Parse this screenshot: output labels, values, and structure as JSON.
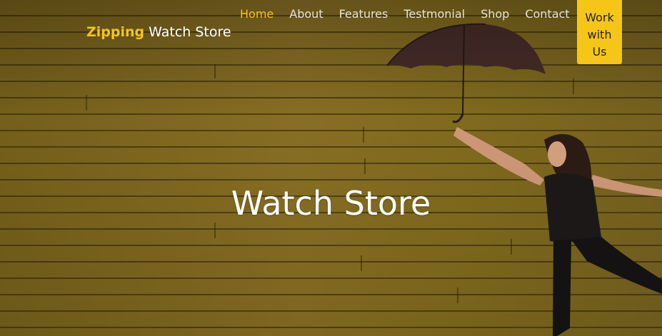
{
  "brand": {
    "accent": "Zipping",
    "rest": " Watch Store"
  },
  "nav": {
    "items": [
      "Home",
      "About",
      "Features",
      "Testmonial",
      "Shop",
      "Contact"
    ],
    "active": "Home"
  },
  "cta": {
    "line1": "Work",
    "line2": "with",
    "line3": "Us"
  },
  "hero": {
    "title": "Watch Store"
  },
  "colors": {
    "accent": "#f5c518",
    "wall": "#8a6f1f",
    "text": "#ffffff"
  },
  "image": {
    "subject": "woman-with-umbrella-icon"
  }
}
